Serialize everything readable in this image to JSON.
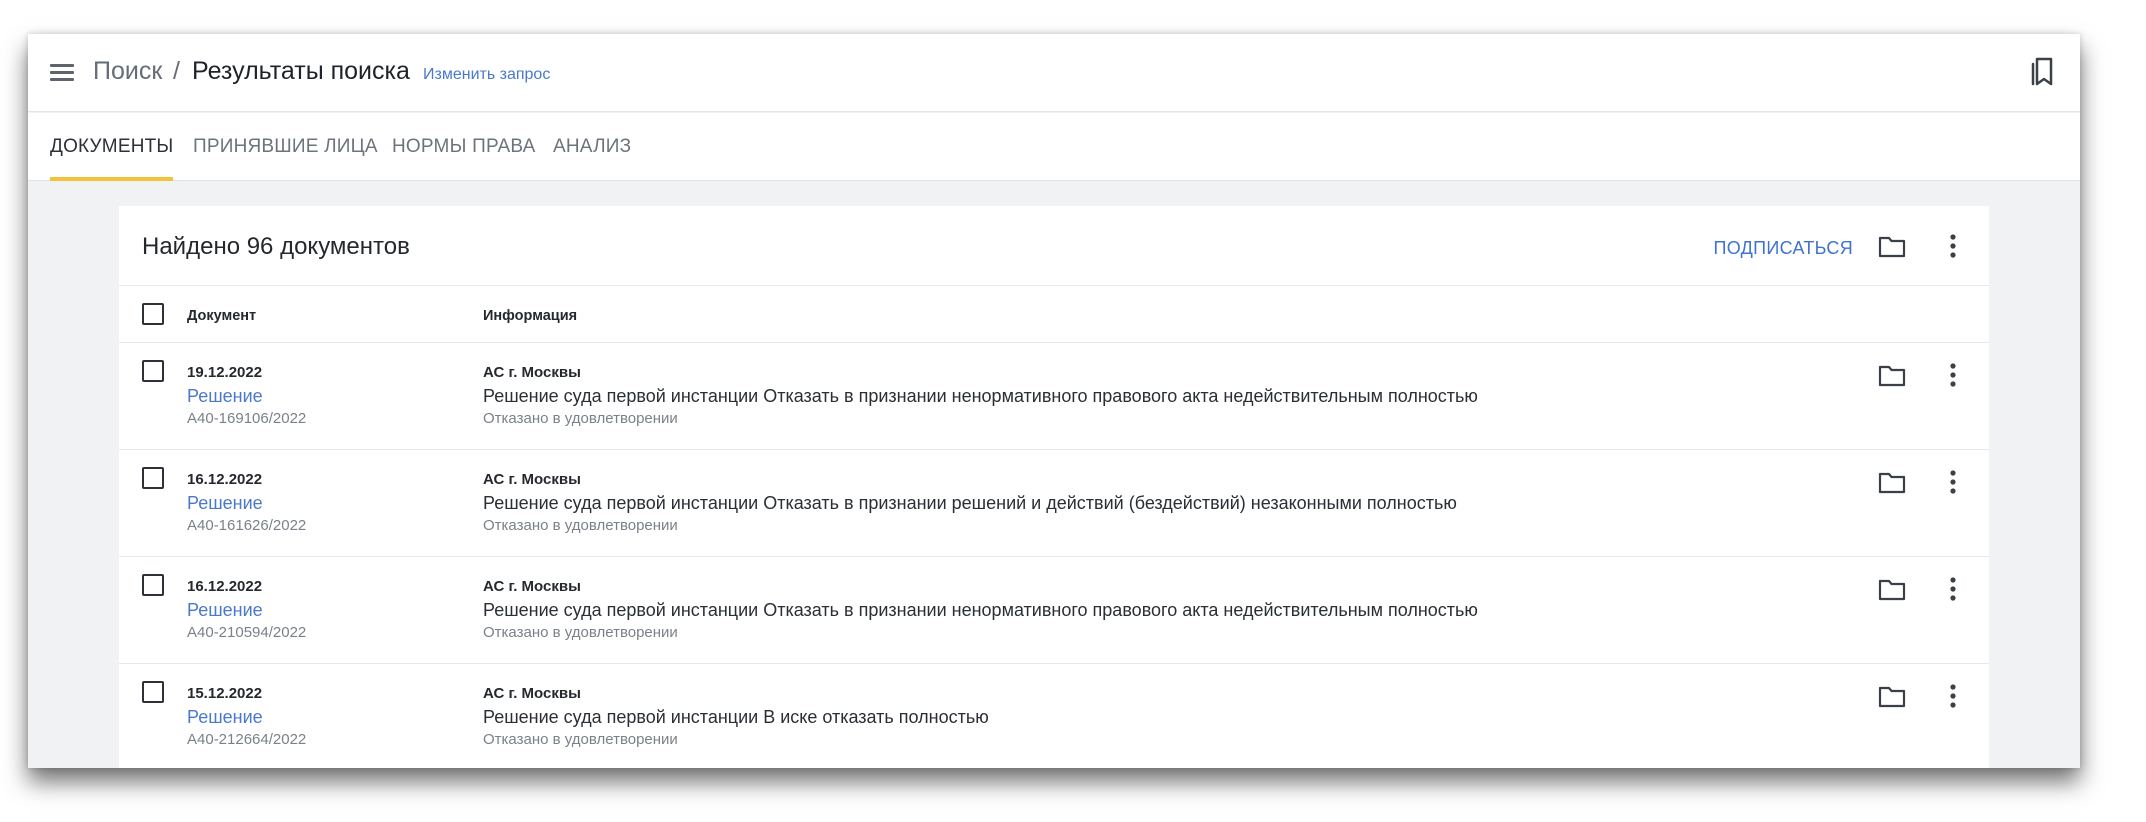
{
  "header": {
    "breadcrumb_root": "Поиск",
    "breadcrumb_separator": "/",
    "title": "Результаты поиска",
    "edit_query": "Изменить запрос",
    "icons": {
      "menu": "hamburger-menu-icon",
      "bookmarks": "bookmarks-icon"
    }
  },
  "tabs": [
    {
      "label": "ДОКУМЕНТЫ",
      "active": true
    },
    {
      "label": "ПРИНЯВШИЕ ЛИЦА",
      "active": false
    },
    {
      "label": "НОРМЫ ПРАВА",
      "active": false
    },
    {
      "label": "АНАЛИЗ",
      "active": false
    }
  ],
  "results": {
    "count_text": "Найдено 96 документов",
    "subscribe_label": "ПОДПИСАТЬСЯ",
    "columns": {
      "document": "Документ",
      "info": "Информация"
    },
    "rows": [
      {
        "date": "19.12.2022",
        "type": "Решение",
        "case_number": "А40-169106/2022",
        "court": "АС г. Москвы",
        "summary": "Решение суда первой инстанции Отказать в признании ненормативного правового акта недействительным полностью",
        "result": "Отказано в удовлетворении"
      },
      {
        "date": "16.12.2022",
        "type": "Решение",
        "case_number": "А40-161626/2022",
        "court": "АС г. Москвы",
        "summary": "Решение суда первой инстанции Отказать в признании решений и действий (бездействий) незаконными полностью",
        "result": "Отказано в удовлетворении"
      },
      {
        "date": "16.12.2022",
        "type": "Решение",
        "case_number": "А40-210594/2022",
        "court": "АС г. Москвы",
        "summary": "Решение суда первой инстанции Отказать в признании ненормативного правового акта недействительным полностью",
        "result": "Отказано в удовлетворении"
      },
      {
        "date": "15.12.2022",
        "type": "Решение",
        "case_number": "А40-212664/2022",
        "court": "АС г. Москвы",
        "summary": "Решение суда первой инстанции В иске отказать полностью",
        "result": "Отказано в удовлетворении"
      }
    ]
  },
  "colors": {
    "accent_link": "#4a79cc",
    "active_tab_underline": "#f3c23c",
    "page_background": "#f1f2f4"
  }
}
